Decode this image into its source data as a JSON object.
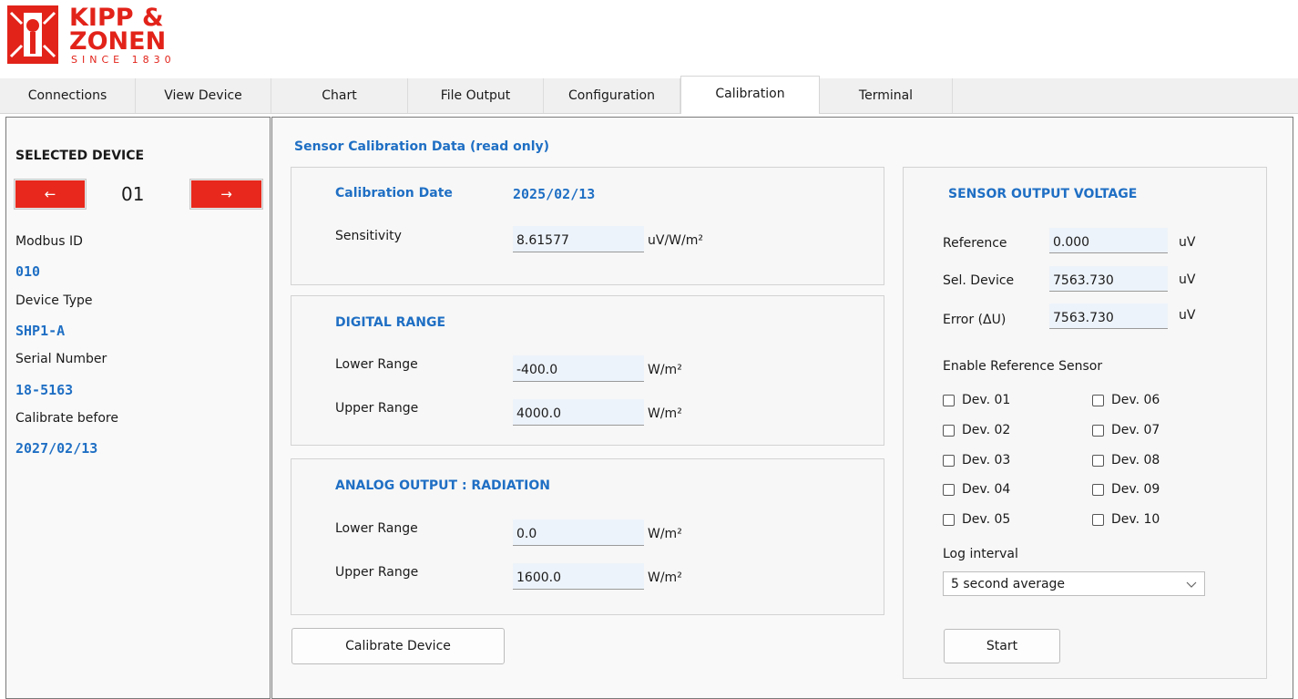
{
  "logo": {
    "line1": "KIPP &",
    "line2": "ZONEN",
    "line3": "SINCE 1830"
  },
  "tabs": [
    {
      "label": "Connections"
    },
    {
      "label": "View Device"
    },
    {
      "label": "Chart"
    },
    {
      "label": "File Output"
    },
    {
      "label": "Configuration"
    },
    {
      "label": "Calibration"
    },
    {
      "label": "Terminal"
    }
  ],
  "sidebar": {
    "heading": "SELECTED DEVICE",
    "prev_icon": "left-arrow-icon",
    "next_icon": "right-arrow-icon",
    "prev_glyph": "←",
    "next_glyph": "→",
    "device_number": "01",
    "modbus_label": "Modbus ID",
    "modbus_value": "010",
    "type_label": "Device Type",
    "type_value": "SHP1-A",
    "serial_label": "Serial Number",
    "serial_value": "18-5163",
    "calibrate_label": "Calibrate before",
    "calibrate_value": "2027/02/13"
  },
  "main": {
    "title": "Sensor Calibration Data (read  only)",
    "calibration": {
      "date_label": "Calibration Date",
      "date_value": "2025/02/13",
      "sensitivity_label": "Sensitivity",
      "sensitivity_value": "8.61577",
      "sensitivity_unit": "uV/W/m²"
    },
    "digital_range": {
      "heading": "DIGITAL RANGE",
      "lower_label": "Lower Range",
      "lower_value": "-400.0",
      "upper_label": "Upper Range",
      "upper_value": "4000.0",
      "unit": "W/m²"
    },
    "analog_output": {
      "heading": "ANALOG OUTPUT : RADIATION",
      "lower_label": "Lower Range",
      "lower_value": "0.0",
      "upper_label": "Upper Range",
      "upper_value": "1600.0",
      "unit": "W/m²"
    },
    "calibrate_button": "Calibrate Device"
  },
  "voltage": {
    "heading": "SENSOR OUTPUT VOLTAGE",
    "reference_label": "Reference",
    "reference_value": "0.000",
    "seldevice_label": "Sel. Device",
    "seldevice_value": "7563.730",
    "error_label": "Error (ΔU)",
    "error_value": "7563.730",
    "unit": "uV",
    "enable_label": "Enable Reference Sensor",
    "devices": [
      "Dev. 01",
      "Dev. 02",
      "Dev. 03",
      "Dev. 04",
      "Dev. 05",
      "Dev. 06",
      "Dev. 07",
      "Dev. 08",
      "Dev. 09",
      "Dev. 10"
    ],
    "log_label": "Log interval",
    "log_value": "5 second average",
    "start_button": "Start"
  },
  "colors": {
    "accent": "#1f6fc4",
    "arrow_button": "#e8281c",
    "brand": "#e2231a"
  }
}
